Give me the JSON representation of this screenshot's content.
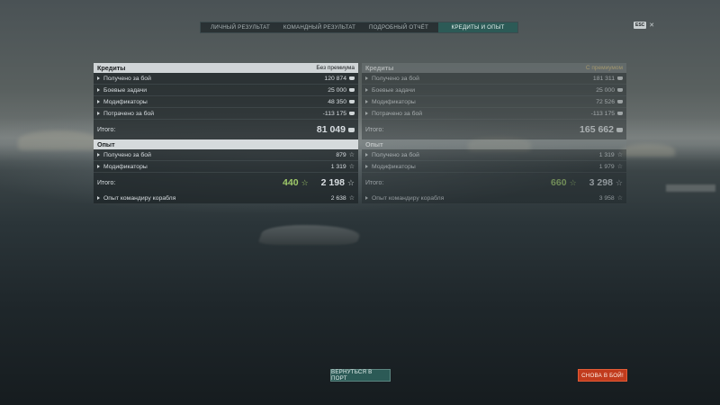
{
  "tabs": [
    "Личный результат",
    "Командный результат",
    "Подробный отчёт",
    "Кредиты и опыт"
  ],
  "active_tab": "Кредиты и опыт",
  "top_right": {
    "key_badge": "ESC",
    "close_symbol": "✕"
  },
  "left": {
    "credits": {
      "header": "Кредиты",
      "subheader": "Без премиума",
      "rows": [
        {
          "label": "Получено за бой",
          "value": "120 874"
        },
        {
          "label": "Боевые задачи",
          "value": "25 000"
        },
        {
          "label": "Модификаторы",
          "value": "48 350"
        },
        {
          "label": "Потрачено за бой",
          "value": "-113 175"
        }
      ],
      "total_label": "Итого:",
      "total_value": "81 049"
    },
    "xp": {
      "header": "Опыт",
      "rows": [
        {
          "label": "Получено за бой",
          "value": "879"
        },
        {
          "label": "Модификаторы",
          "value": "1 319"
        }
      ],
      "total_label": "Итого:",
      "bonus_value": "440",
      "total_value": "2 198"
    },
    "commander": {
      "label": "Опыт командиру корабля",
      "value": "2 638"
    }
  },
  "right": {
    "credits": {
      "header": "Кредиты",
      "subheader": "С премиумом",
      "rows": [
        {
          "label": "Получено за бой",
          "value": "181 311"
        },
        {
          "label": "Боевые задачи",
          "value": "25 000"
        },
        {
          "label": "Модификаторы",
          "value": "72 526"
        },
        {
          "label": "Потрачено за бой",
          "value": "-113 175"
        }
      ],
      "total_label": "Итого:",
      "total_value": "165 662"
    },
    "xp": {
      "header": "Опыт",
      "rows": [
        {
          "label": "Получено за бой",
          "value": "1 319"
        },
        {
          "label": "Модификаторы",
          "value": "1 979"
        }
      ],
      "total_label": "Итого:",
      "bonus_value": "660",
      "total_value": "3 298"
    },
    "commander": {
      "label": "Опыт командиру корабля",
      "value": "3 958"
    }
  },
  "buttons": {
    "return_port": "Вернуться в порт",
    "to_battle": "Снова в бой!"
  },
  "colors": {
    "accent_teal": "#2c5a56",
    "battle_red": "#c13b1d",
    "bonus_green": "#9fca6a",
    "premium_gold": "#e0c67b"
  },
  "icons": {
    "credits": "credits-coin-icon",
    "xp": "xp-star-icon",
    "row_marker": "triangle-right-icon"
  }
}
